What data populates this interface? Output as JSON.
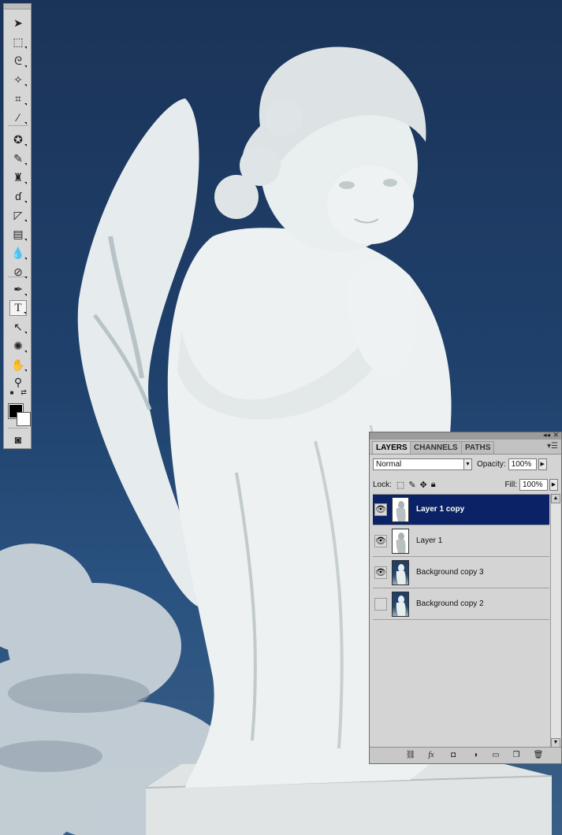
{
  "toolbox": {
    "tools": [
      {
        "name": "move-tool-icon",
        "glyph": "➤",
        "flyout": false
      },
      {
        "name": "marquee-tool-icon",
        "glyph": "⬚",
        "flyout": true
      },
      {
        "name": "lasso-tool-icon",
        "glyph": "ᘓ",
        "flyout": true
      },
      {
        "name": "magic-wand-tool-icon",
        "glyph": "✧",
        "flyout": true
      },
      {
        "name": "crop-tool-icon",
        "glyph": "⌗",
        "flyout": true
      },
      {
        "name": "eyedropper-tool-icon",
        "glyph": "⁄",
        "flyout": true
      },
      {
        "name": "healing-brush-tool-icon",
        "glyph": "✪",
        "flyout": true
      },
      {
        "name": "brush-tool-icon",
        "glyph": "✎",
        "flyout": true
      },
      {
        "name": "clone-stamp-tool-icon",
        "glyph": "♜",
        "flyout": true
      },
      {
        "name": "history-brush-tool-icon",
        "glyph": "ɗ",
        "flyout": true
      },
      {
        "name": "eraser-tool-icon",
        "glyph": "◸",
        "flyout": true
      },
      {
        "name": "gradient-tool-icon",
        "glyph": "▤",
        "flyout": true
      },
      {
        "name": "blur-tool-icon",
        "glyph": "💧",
        "flyout": true
      },
      {
        "name": "dodge-tool-icon",
        "glyph": "⊘",
        "flyout": true
      },
      {
        "name": "pen-tool-icon",
        "glyph": "✒",
        "flyout": true
      },
      {
        "name": "type-tool-icon",
        "glyph": "T",
        "flyout": true,
        "selected": true
      },
      {
        "name": "path-selection-tool-icon",
        "glyph": "↖",
        "flyout": true
      },
      {
        "name": "shape-tool-icon",
        "glyph": "✺",
        "flyout": true
      },
      {
        "name": "hand-tool-icon",
        "glyph": "✋",
        "flyout": true
      },
      {
        "name": "zoom-tool-icon",
        "glyph": "⚲",
        "flyout": false
      }
    ],
    "colors": {
      "foreground": "#000000",
      "background": "#ffffff"
    }
  },
  "layers_panel": {
    "tabs": [
      {
        "label": "LAYERS",
        "active": true
      },
      {
        "label": "CHANNELS",
        "active": false
      },
      {
        "label": "PATHS",
        "active": false
      }
    ],
    "blend_mode": "Normal",
    "opacity_label": "Opacity:",
    "opacity_value": "100%",
    "lock_label": "Lock:",
    "fill_label": "Fill:",
    "fill_value": "100%",
    "layers": [
      {
        "name": "Layer 1 copy",
        "visible": true,
        "selected": true,
        "thumb": "statue-white"
      },
      {
        "name": "Layer 1",
        "visible": true,
        "selected": false,
        "thumb": "statue-white"
      },
      {
        "name": "Background copy 3",
        "visible": true,
        "selected": false,
        "thumb": "photo"
      },
      {
        "name": "Background copy 2",
        "visible": false,
        "selected": false,
        "thumb": "photo"
      }
    ],
    "selected_color": "#0b2366"
  }
}
